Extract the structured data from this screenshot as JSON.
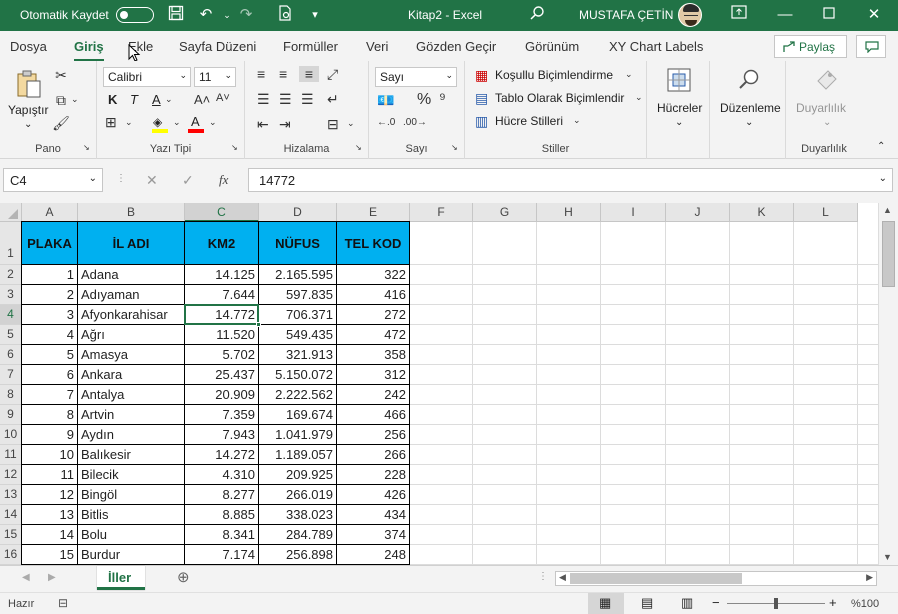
{
  "titlebar": {
    "autosave_label": "Otomatik Kaydet",
    "doc_title": "Kitap2 - Excel",
    "user_name": "MUSTAFA ÇETİN"
  },
  "menu": {
    "tabs": [
      "Dosya",
      "Giriş",
      "Ekle",
      "Sayfa Düzeni",
      "Formüller",
      "Veri",
      "Gözden Geçir",
      "Görünüm",
      "XY Chart Labels"
    ],
    "active": "Giriş",
    "share_label": "Paylaş"
  },
  "ribbon": {
    "clipboard": {
      "paste_label": "Yapıştır",
      "group_label": "Pano"
    },
    "font": {
      "font_name": "Calibri",
      "font_size": "11",
      "bold": "K",
      "italic": "T",
      "underline": "A",
      "group_label": "Yazı Tipi"
    },
    "alignment": {
      "group_label": "Hizalama"
    },
    "number": {
      "format": "Sayı",
      "group_label": "Sayı"
    },
    "styles": {
      "conditional": "Koşullu Biçimlendirme",
      "table": "Tablo Olarak Biçimlendir",
      "cell_styles": "Hücre Stilleri",
      "group_label": "Stiller"
    },
    "cells": {
      "label": "Hücreler"
    },
    "editing": {
      "label": "Düzenleme"
    },
    "sensitivity": {
      "label": "Duyarlılık",
      "group_label": "Duyarlılık"
    }
  },
  "formula_bar": {
    "name_box": "C4",
    "fx": "fx",
    "value": "14772"
  },
  "sheet": {
    "columns": [
      "A",
      "B",
      "C",
      "D",
      "E",
      "F",
      "G",
      "H",
      "I",
      "J",
      "K",
      "L"
    ],
    "selected_column": "C",
    "selected_row": "4",
    "rows_numbers": [
      "1",
      "2",
      "3",
      "4",
      "5",
      "6",
      "7",
      "8",
      "9",
      "10",
      "11",
      "12",
      "13",
      "14",
      "15",
      "16"
    ],
    "headers": [
      "PLAKA",
      "İL ADI",
      "KM2",
      "NÜFUS",
      "TEL KOD"
    ],
    "rows": [
      [
        "1",
        "Adana",
        "14.125",
        "2.165.595",
        "322"
      ],
      [
        "2",
        "Adıyaman",
        "7.644",
        "597.835",
        "416"
      ],
      [
        "3",
        "Afyonkarahisar",
        "14.772",
        "706.371",
        "272"
      ],
      [
        "4",
        "Ağrı",
        "11.520",
        "549.435",
        "472"
      ],
      [
        "5",
        "Amasya",
        "5.702",
        "321.913",
        "358"
      ],
      [
        "6",
        "Ankara",
        "25.437",
        "5.150.072",
        "312"
      ],
      [
        "7",
        "Antalya",
        "20.909",
        "2.222.562",
        "242"
      ],
      [
        "8",
        "Artvin",
        "7.359",
        "169.674",
        "466"
      ],
      [
        "9",
        "Aydın",
        "7.943",
        "1.041.979",
        "256"
      ],
      [
        "10",
        "Balıkesir",
        "14.272",
        "1.189.057",
        "266"
      ],
      [
        "11",
        "Bilecik",
        "4.310",
        "209.925",
        "228"
      ],
      [
        "12",
        "Bingöl",
        "8.277",
        "266.019",
        "426"
      ],
      [
        "13",
        "Bitlis",
        "8.885",
        "338.023",
        "434"
      ],
      [
        "14",
        "Bolu",
        "8.341",
        "284.789",
        "374"
      ],
      [
        "15",
        "Burdur",
        "7.174",
        "256.898",
        "248"
      ]
    ]
  },
  "sheet_tabs": {
    "active": "İller"
  },
  "status": {
    "ready": "Hazır",
    "zoom": "%100"
  },
  "colors": {
    "excel_green": "#217346",
    "header_fill": "#00b0f0"
  }
}
